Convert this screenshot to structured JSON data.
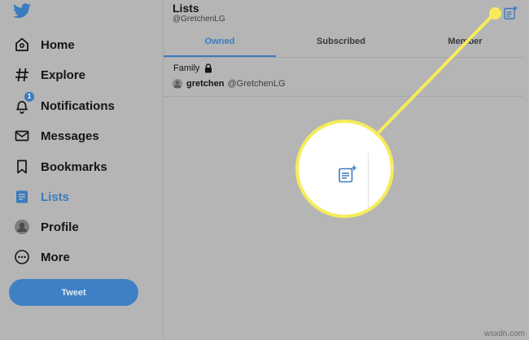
{
  "sidebar": {
    "items": [
      {
        "label": "Home",
        "icon": "home-icon"
      },
      {
        "label": "Explore",
        "icon": "hashtag-icon"
      },
      {
        "label": "Notifications",
        "icon": "bell-icon",
        "badge": "1"
      },
      {
        "label": "Messages",
        "icon": "envelope-icon"
      },
      {
        "label": "Bookmarks",
        "icon": "bookmark-icon"
      },
      {
        "label": "Lists",
        "icon": "list-icon",
        "active": true
      },
      {
        "label": "Profile",
        "icon": "avatar-icon"
      },
      {
        "label": "More",
        "icon": "more-icon"
      }
    ],
    "tweet_label": "Tweet"
  },
  "header": {
    "title": "Lists",
    "handle": "@GretchenLG"
  },
  "tabs": [
    {
      "label": "Owned",
      "active": true
    },
    {
      "label": "Subscribed"
    },
    {
      "label": "Member"
    }
  ],
  "lists": [
    {
      "name": "Family",
      "private": true,
      "owner_name": "gretchen",
      "owner_handle": "@GretchenLG"
    }
  ],
  "watermark": "wsxdn.com",
  "colors": {
    "accent": "#3a7bbf",
    "highlight": "#f6ec5a",
    "background": "#b5b5b5"
  }
}
